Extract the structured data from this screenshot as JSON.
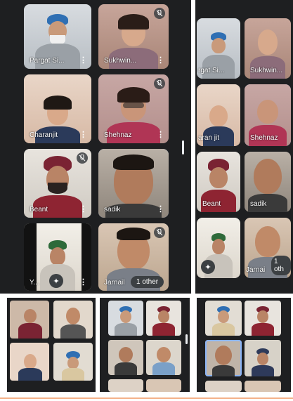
{
  "main": {
    "participants": [
      {
        "name": "Pargat Si...",
        "muted": false
      },
      {
        "name": "Sukhwin...",
        "muted": true
      },
      {
        "name": "Charanjit",
        "muted": false
      },
      {
        "name": "Shehnaz",
        "muted": true
      },
      {
        "name": "Beant",
        "muted": true
      },
      {
        "name": "sadik",
        "muted": false
      },
      {
        "name": "Y...",
        "muted": false
      },
      {
        "name": "Jarnail",
        "muted": true
      }
    ],
    "others_chip": "1 other"
  },
  "right": {
    "participants": [
      {
        "name": "rgat Si..."
      },
      {
        "name": "Sukhwin..."
      },
      {
        "name": "aran jit"
      },
      {
        "name": "Shehnaz"
      },
      {
        "name": "Beant"
      },
      {
        "name": "sadik"
      },
      {
        "name": "Jarnai"
      }
    ],
    "others_chip": "1 oth"
  },
  "icons": {
    "mute": "mic-off-icon",
    "more": "more-vert-icon",
    "effects": "sparkle-icon"
  },
  "colors": {
    "panel_bg": "#1e1f21",
    "active_border": "#8ab4f8",
    "chip_bg": "#3c4043"
  }
}
